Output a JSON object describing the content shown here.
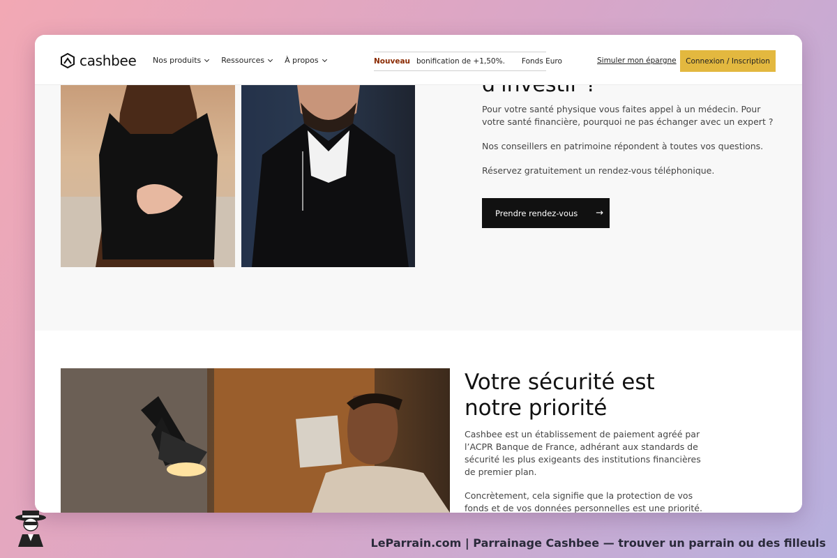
{
  "header": {
    "logo_text": "cashbee",
    "nav": [
      {
        "label": "Nos produits"
      },
      {
        "label": "Ressources"
      },
      {
        "label": "À propos"
      }
    ],
    "ticker": {
      "badge": "Nouveau",
      "message": "bonification de +1,50%.",
      "next": "Fonds Euro"
    },
    "simulate_label": "Simuler mon épargne",
    "login_label": "Connexion / Inscription"
  },
  "advisor_section": {
    "heading_partial": "d'investir ?",
    "paragraphs": [
      "Pour votre santé physique vous faites appel à un médecin. Pour votre santé financière, pourquoi ne pas échanger avec un expert ?",
      "Nos conseillers en patrimoine répondent à toutes vos questions.",
      "Réservez gratuitement un rendez-vous téléphonique."
    ],
    "cta_label": "Prendre rendez-vous",
    "cta_arrow": "→"
  },
  "security_section": {
    "title_line1": "Votre sécurité est",
    "title_line2": "notre priorité",
    "paragraph1": "Cashbee est un établissement de paiement agréé par l’ACPR Banque de France, adhérant aux standards de sécurité les plus exigeants des institutions financières de premier plan.",
    "paragraph2": "Concrètement, cela signifie que la protection de vos fonds et de vos données personnelles est une priorité."
  },
  "footer": {
    "text": "LeParrain.com | Parrainage Cashbee — trouver un parrain ou des filleuls"
  }
}
